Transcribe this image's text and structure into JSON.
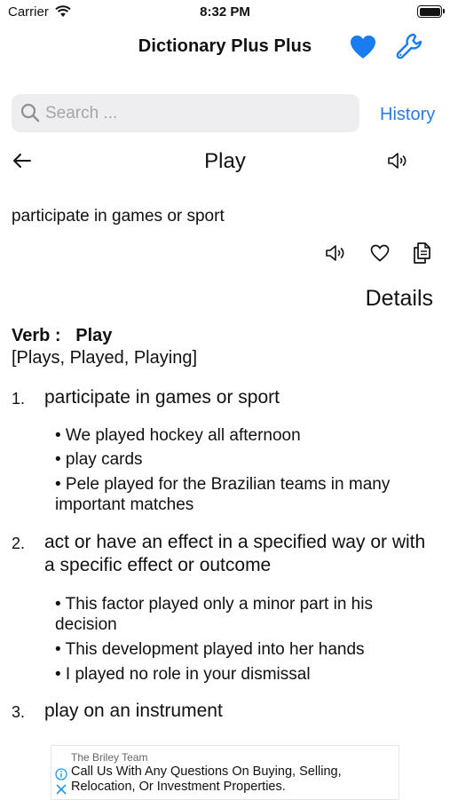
{
  "status_bar": {
    "carrier": "Carrier",
    "time": "8:32 PM"
  },
  "nav": {
    "title": "Dictionary Plus Plus",
    "icons": [
      "heart-icon",
      "wrench-icon"
    ],
    "accent": "#1a7cf0"
  },
  "search": {
    "placeholder": "Search ...",
    "value": "",
    "history_label": "History"
  },
  "entry": {
    "word": "Play",
    "short_definition": "participate in games or sport",
    "details_label": "Details",
    "part_of_speech": "Verb :",
    "headword": "Play",
    "forms": "[Plays, Played, Playing]",
    "senses": [
      {
        "number": "1.",
        "definition": "participate in games or sport",
        "examples": [
          "• We played hockey all afternoon",
          "• play cards",
          "• Pele played for the Brazilian teams in many important matches"
        ]
      },
      {
        "number": "2.",
        "definition": "act or have an effect in a specified way or with a specific effect or outcome",
        "examples": [
          "• This factor played only a minor part in his decision",
          "• This development played into her hands",
          "• I played no role in your dismissal"
        ]
      },
      {
        "number": "3.",
        "definition": "play on an instrument",
        "examples": []
      }
    ]
  },
  "ad": {
    "brand": "The Briley Team",
    "text": "Call Us With Any Questions On Buying, Selling, Relocation, Or Investment Properties.",
    "info_color": "#1a9be8"
  }
}
